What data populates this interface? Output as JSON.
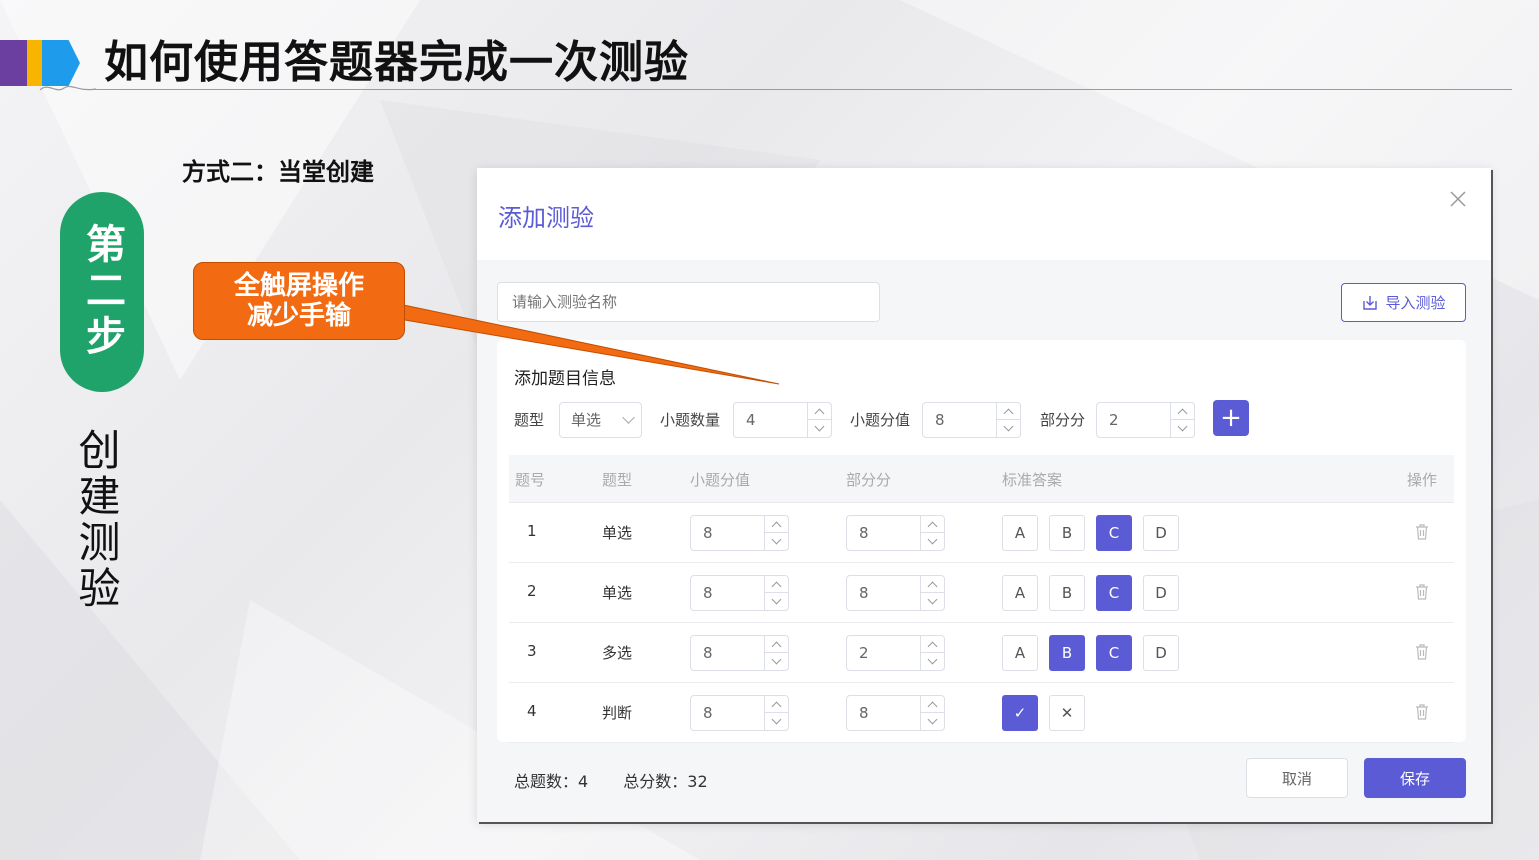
{
  "slide": {
    "title": "如何使用答题器完成一次测验",
    "step_badge": "第二步",
    "step_name": "创建测验",
    "method_label": "方式二：当堂创建",
    "callout_line1": "全触屏操作",
    "callout_line2": "减少手输",
    "colors": {
      "bar_purple": "#6b3fa0",
      "bar_yellow": "#f7b500",
      "bar_blue": "#1e9bea",
      "step_green": "#1fa36b",
      "callout_orange": "#f26a12",
      "accent": "#5b5bd6"
    }
  },
  "dialog": {
    "title": "添加测验",
    "close_icon": "close-icon",
    "name_placeholder": "请输入测验名称",
    "import_label": "导入测验",
    "section_title": "添加题目信息",
    "form": {
      "type_label": "题型",
      "type_value": "单选",
      "count_label": "小题数量",
      "count_value": "4",
      "score_label": "小题分值",
      "score_value": "8",
      "partial_label": "部分分",
      "partial_value": "2",
      "add_label": "+"
    },
    "table": {
      "headers": [
        "题号",
        "题型",
        "小题分值",
        "部分分",
        "标准答案",
        "操作"
      ],
      "rows": [
        {
          "no": "1",
          "type": "单选",
          "score": "8",
          "partial": "8",
          "options": [
            "A",
            "B",
            "C",
            "D"
          ],
          "selected": [
            "C"
          ]
        },
        {
          "no": "2",
          "type": "单选",
          "score": "8",
          "partial": "8",
          "options": [
            "A",
            "B",
            "C",
            "D"
          ],
          "selected": [
            "C"
          ]
        },
        {
          "no": "3",
          "type": "多选",
          "score": "8",
          "partial": "2",
          "options": [
            "A",
            "B",
            "C",
            "D"
          ],
          "selected": [
            "B",
            "C"
          ]
        },
        {
          "no": "4",
          "type": "判断",
          "score": "8",
          "partial": "8",
          "options": [
            "✓",
            "✕"
          ],
          "selected": [
            "✓"
          ]
        }
      ]
    },
    "footer": {
      "total_questions": "总题数：4",
      "total_score": "总分数：32",
      "cancel_label": "取消",
      "save_label": "保存"
    }
  }
}
